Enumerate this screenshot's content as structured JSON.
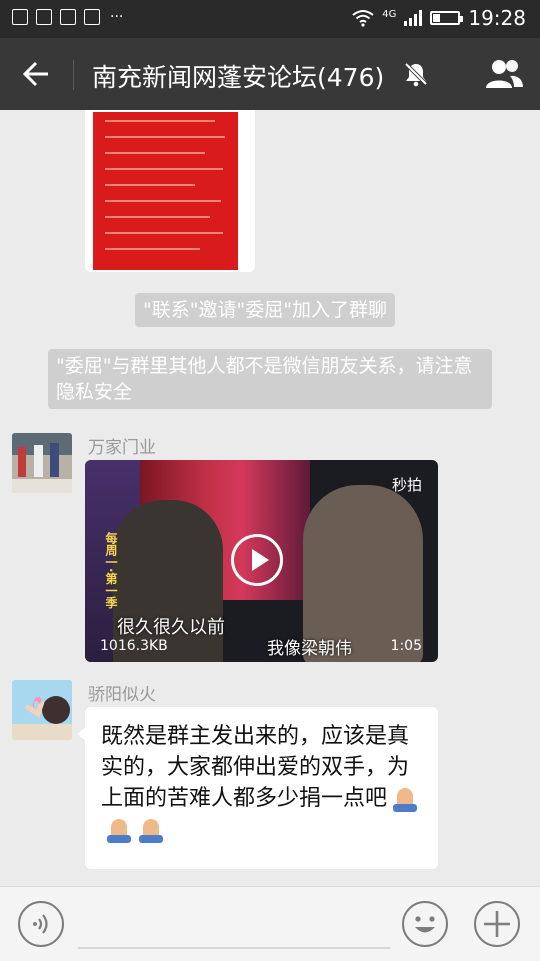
{
  "status_bar": {
    "time": "19:28",
    "network": "4G",
    "more": "···"
  },
  "header": {
    "title": "南充新闻网蓬安论坛(476)"
  },
  "messages": [
    {
      "kind": "image"
    },
    {
      "kind": "system",
      "text": "\"联系\"邀请\"委屈\"加入了群聊"
    },
    {
      "kind": "system",
      "text": "\"委屈\"与群里其他人都不是微信朋友关系，请注意隐私安全"
    },
    {
      "kind": "video",
      "sender": "万家门业",
      "logo": "秒拍",
      "badge_text": "每周一·第一季",
      "subtitle_left": "很久很久以前",
      "subtitle_right": "我像梁朝伟",
      "file_size": "1016.3KB",
      "duration": "1:05"
    },
    {
      "kind": "text",
      "sender": "骄阳似火",
      "text": "既然是群主发出来的，应该是真实的，大家都伸出爱的双手，为上面的苦难人都多少捐一点吧"
    }
  ]
}
